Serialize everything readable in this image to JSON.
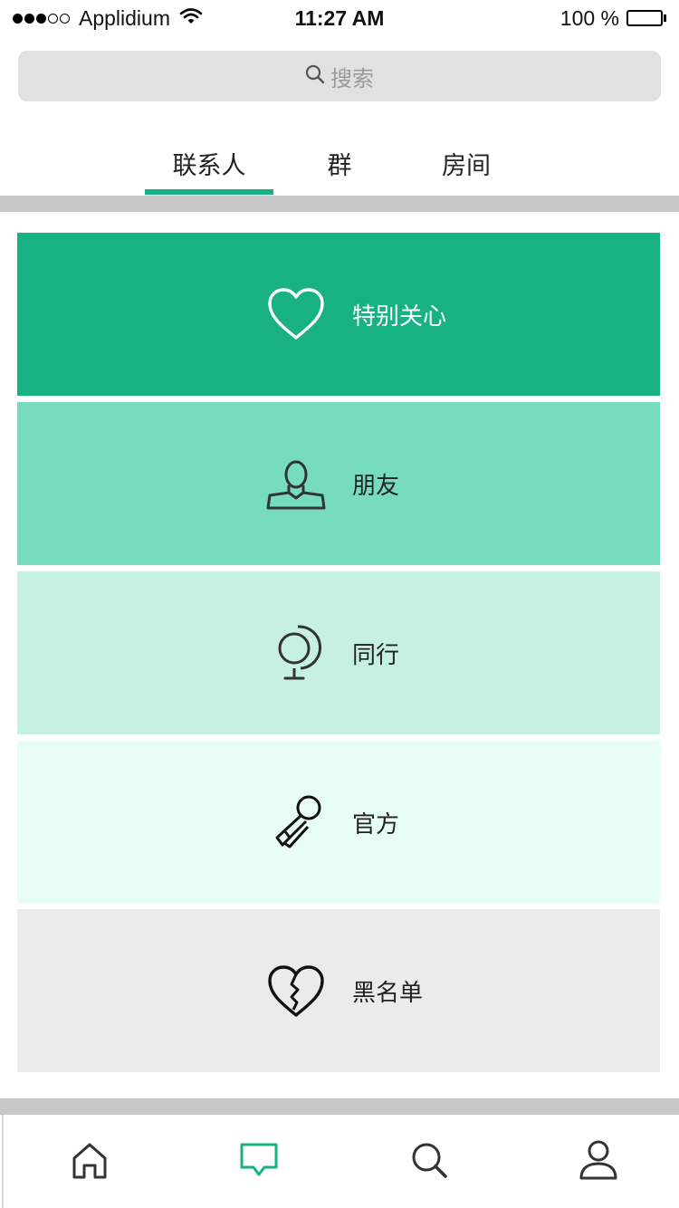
{
  "status_bar": {
    "carrier": "Applidium",
    "time": "11:27 AM",
    "battery": "100 %",
    "signal_bars_filled": 3,
    "signal_bars_total": 5
  },
  "search": {
    "placeholder": "搜索",
    "icon": "search-icon"
  },
  "tabs": [
    {
      "label": "联系人",
      "active": true
    },
    {
      "label": "群",
      "active": false
    },
    {
      "label": "房间",
      "active": false
    }
  ],
  "categories": [
    {
      "label": "特别关心",
      "icon": "heart-icon",
      "background": "#17b183",
      "text_color": "#ffffff"
    },
    {
      "label": "朋友",
      "icon": "person-icon",
      "background": "#77dcbd",
      "text_color": "#222222"
    },
    {
      "label": "同行",
      "icon": "globe-icon",
      "background": "#c5f0e2",
      "text_color": "#222222"
    },
    {
      "label": "官方",
      "icon": "microphone-icon",
      "background": "#e8fdf5",
      "text_color": "#222222"
    },
    {
      "label": "黑名单",
      "icon": "broken-heart-icon",
      "background": "#ebebeb",
      "text_color": "#222222"
    }
  ],
  "bottom_nav": [
    {
      "name": "home",
      "icon": "home-icon",
      "active": false
    },
    {
      "name": "messages",
      "icon": "chat-icon",
      "active": true
    },
    {
      "name": "search",
      "icon": "search-icon",
      "active": false
    },
    {
      "name": "profile",
      "icon": "user-icon",
      "active": false
    }
  ],
  "colors": {
    "accent": "#17b183",
    "divider": "#c7c7c7",
    "search_bg": "#e1e1e1",
    "icon_dark": "#333333"
  }
}
